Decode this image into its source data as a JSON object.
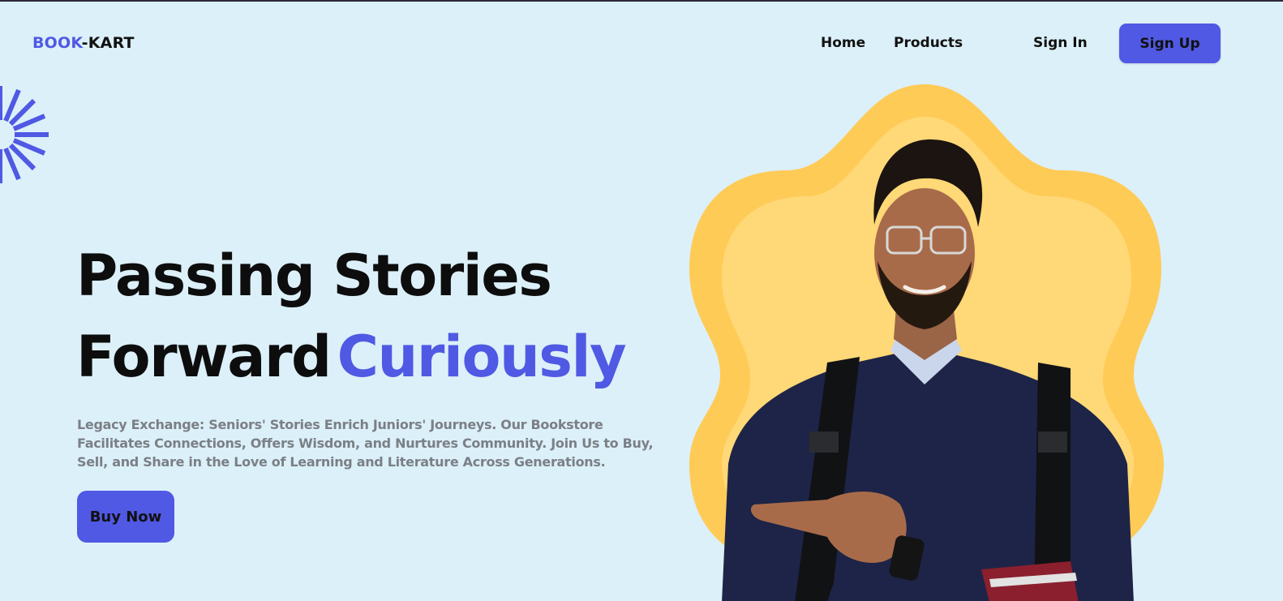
{
  "header": {
    "logo_part1": "BOOK",
    "logo_part2": "-KART",
    "nav": {
      "home": "Home",
      "products": "Products",
      "signin": "Sign In",
      "signup": "Sign Up"
    }
  },
  "hero": {
    "title_line1": "Passing Stories",
    "title_line2": "Forward",
    "title_accent": "Curiously",
    "description": "Legacy Exchange: Seniors' Stories Enrich Juniors' Journeys. Our Bookstore Facilitates Connections, Offers Wisdom, and Nurtures Community. Join Us to Buy, Sell, and Share in the Love of Learning and Literature Across Generations.",
    "cta": "Buy Now"
  },
  "colors": {
    "background": "#dcf0f9",
    "accent": "#5059e3",
    "blob_outer": "#ffcb57",
    "blob_inner": "#ffd877",
    "text": "#0d0d0d",
    "muted_text": "#7b7f86"
  },
  "icons": {
    "decoration": "starburst-icon"
  }
}
